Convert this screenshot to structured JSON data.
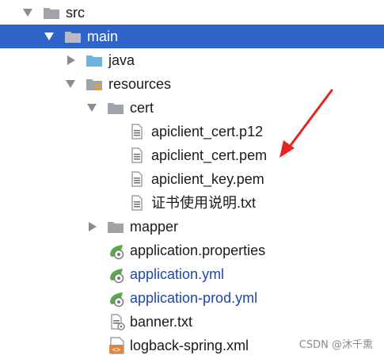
{
  "tree": {
    "items": [
      {
        "label": "src"
      },
      {
        "label": "main"
      },
      {
        "label": "java"
      },
      {
        "label": "resources"
      },
      {
        "label": "cert"
      },
      {
        "label": "apiclient_cert.p12"
      },
      {
        "label": "apiclient_cert.pem"
      },
      {
        "label": "apiclient_key.pem"
      },
      {
        "label": "证书使用说明.txt"
      },
      {
        "label": "mapper"
      },
      {
        "label": "application.properties"
      },
      {
        "label": "application.yml"
      },
      {
        "label": "application-prod.yml"
      },
      {
        "label": "banner.txt"
      },
      {
        "label": "logback-spring.xml"
      }
    ]
  },
  "watermark": "CSDN @沐千熏",
  "colors": {
    "selection": "#2f65ca",
    "modified_text": "#1e47a6",
    "folder": "#9fa4ab",
    "java_folder": "#6fb3e0",
    "spring_green": "#5ba84d",
    "xml_orange": "#e2873a",
    "annotation_red": "#e8241f"
  },
  "icons": {
    "folder": "folder-icon",
    "source_folder": "java-source-folder-icon",
    "resources": "resources-folder-icon",
    "file": "text-file-icon",
    "spring": "spring-config-icon",
    "xml": "xml-file-icon"
  }
}
